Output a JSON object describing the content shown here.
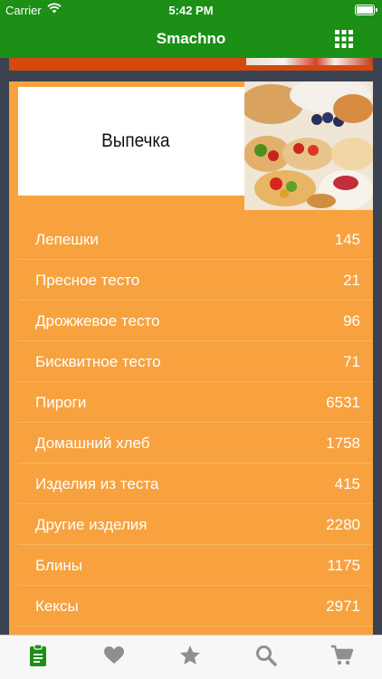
{
  "status_bar": {
    "carrier": "Carrier",
    "time": "5:42 PM"
  },
  "nav": {
    "title": "Smachno",
    "grid_icon": "grid-icon"
  },
  "category": {
    "title": "Выпечка"
  },
  "subcategories": [
    {
      "name": "Лепешки",
      "count": "145"
    },
    {
      "name": "Пресное тесто",
      "count": "21"
    },
    {
      "name": "Дрожжевое тесто",
      "count": "96"
    },
    {
      "name": "Бисквитное тесто",
      "count": "71"
    },
    {
      "name": "Пироги",
      "count": "6531"
    },
    {
      "name": "Домашний хлеб",
      "count": "1758"
    },
    {
      "name": "Изделия из теста",
      "count": "415"
    },
    {
      "name": "Другие изделия",
      "count": "2280"
    },
    {
      "name": "Блины",
      "count": "1175"
    },
    {
      "name": "Кексы",
      "count": "2971"
    }
  ],
  "tabs": [
    {
      "icon": "clipboard-icon",
      "active": true
    },
    {
      "icon": "heart-icon",
      "active": false
    },
    {
      "icon": "star-icon",
      "active": false
    },
    {
      "icon": "search-icon",
      "active": false
    },
    {
      "icon": "cart-icon",
      "active": false
    }
  ],
  "colors": {
    "nav": "#1c8f16",
    "card": "#f7a23f",
    "tab_active": "#1c8f16",
    "tab_inactive": "#8e8e93"
  }
}
